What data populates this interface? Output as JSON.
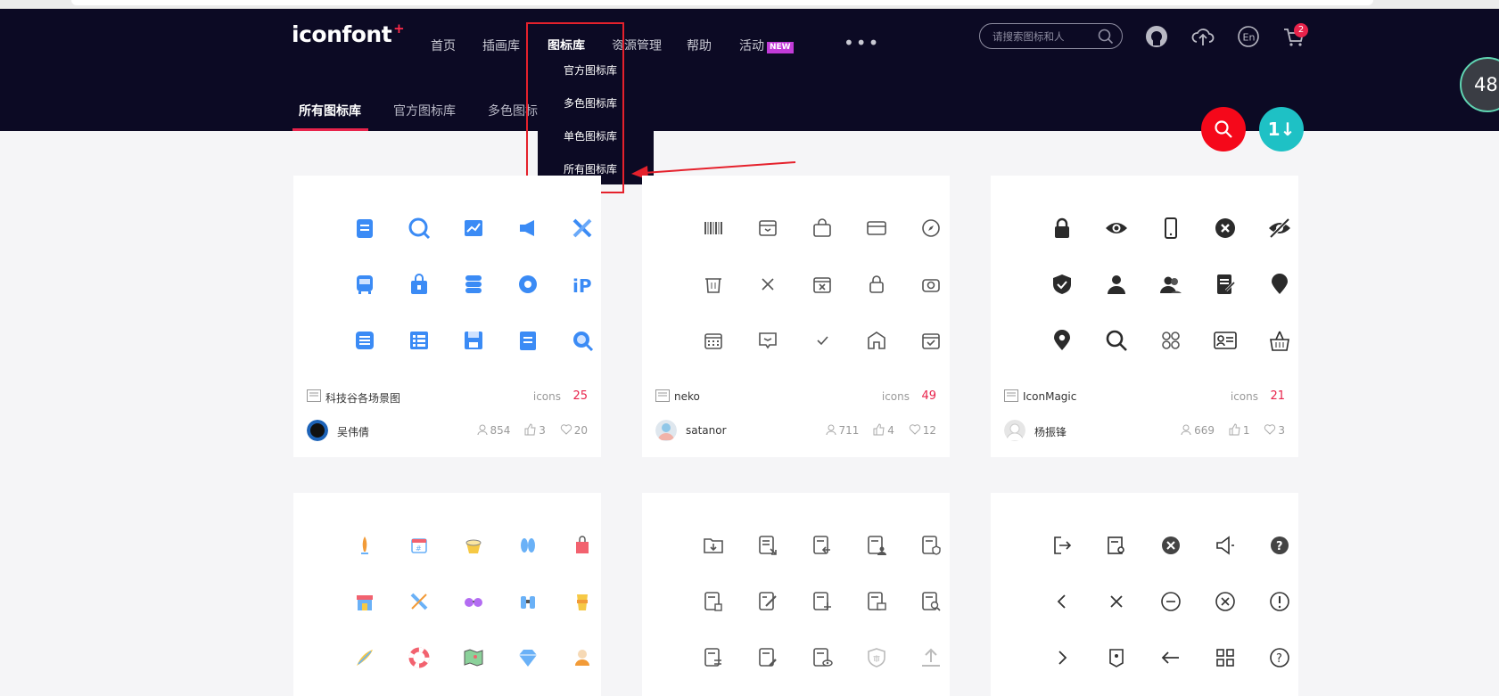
{
  "header": {
    "logo": "iconfont",
    "logo_plus": "+",
    "nav": [
      {
        "label": "首页"
      },
      {
        "label": "插画库"
      },
      {
        "label": "图标库"
      },
      {
        "label": "资源管理"
      },
      {
        "label": "帮助"
      },
      {
        "label": "活动"
      }
    ],
    "new_badge": "NEW",
    "more": "•••",
    "search_placeholder": "请搜索图标和人",
    "cart_count": "2",
    "icons": [
      "github-icon",
      "upload-cloud-icon",
      "language-en-icon",
      "cart-icon"
    ]
  },
  "subnav": [
    {
      "label": "所有图标库"
    },
    {
      "label": "官方图标库"
    },
    {
      "label": "多色图标"
    }
  ],
  "dropdown": {
    "items": [
      "官方图标库",
      "多色图标库",
      "单色图标库",
      "所有图标库"
    ]
  },
  "perf_widget": "48",
  "fab": {
    "sort_label": "1↓"
  },
  "cards": [
    {
      "lib": "科技谷各场景图",
      "icons_label": "icons",
      "count": "25",
      "user": "吴伟倩",
      "fav": "854",
      "likes": "3",
      "hearts": "20",
      "theme": "#2f7cf6"
    },
    {
      "lib": "neko",
      "icons_label": "icons",
      "count": "49",
      "user": "satanor",
      "fav": "711",
      "likes": "4",
      "hearts": "12",
      "theme": "#555"
    },
    {
      "lib": "IconMagic",
      "icons_label": "icons",
      "count": "21",
      "user": "杨振锋",
      "fav": "669",
      "likes": "1",
      "hearts": "3",
      "theme": "#2b2b2b"
    }
  ],
  "colors": {
    "header_bg": "#0c0a24",
    "accent_red": "#e8234b",
    "fab_red": "#f5081a",
    "fab_teal": "#1ec1c5",
    "annotation_red": "#e5212c"
  }
}
